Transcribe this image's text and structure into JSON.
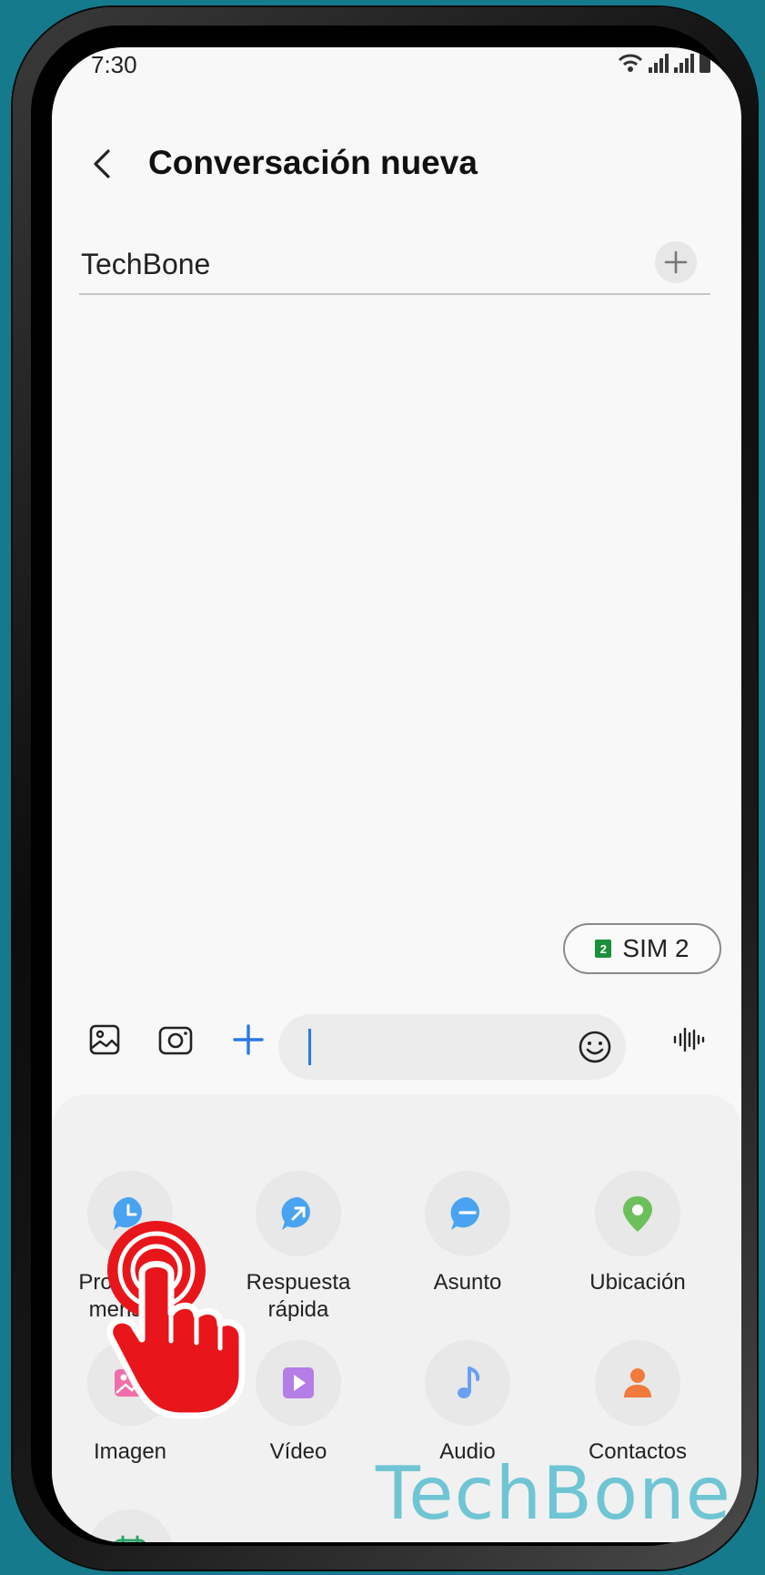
{
  "status_bar": {
    "time": "7:30"
  },
  "header": {
    "title": "Conversación nueva"
  },
  "recipient": {
    "value": "TechBone"
  },
  "sim": {
    "number": "2",
    "label": "SIM 2"
  },
  "attachments": [
    {
      "label": "Programar mensaje",
      "icon": "clock-bubble-icon",
      "color": "#4aa3f0"
    },
    {
      "label": "Respuesta rápida",
      "icon": "quick-reply-icon",
      "color": "#4aa3f0"
    },
    {
      "label": "Asunto",
      "icon": "subject-icon",
      "color": "#4aa3f0"
    },
    {
      "label": "Ubicación",
      "icon": "location-pin-icon",
      "color": "#6cbf5a"
    },
    {
      "label": "Imagen",
      "icon": "image-icon",
      "color": "#f06ea9"
    },
    {
      "label": "Vídeo",
      "icon": "video-icon",
      "color": "#b57de6"
    },
    {
      "label": "Audio",
      "icon": "music-note-icon",
      "color": "#6aa0f2"
    },
    {
      "label": "Contactos",
      "icon": "person-icon",
      "color": "#f07b3c"
    },
    {
      "label": "",
      "icon": "calendar-icon",
      "color": "#2aa366"
    }
  ],
  "watermark": "TechBone",
  "colors": {
    "accent": "#2a7ae2",
    "background": "#157a8c",
    "tap_indicator": "#e8161b"
  }
}
